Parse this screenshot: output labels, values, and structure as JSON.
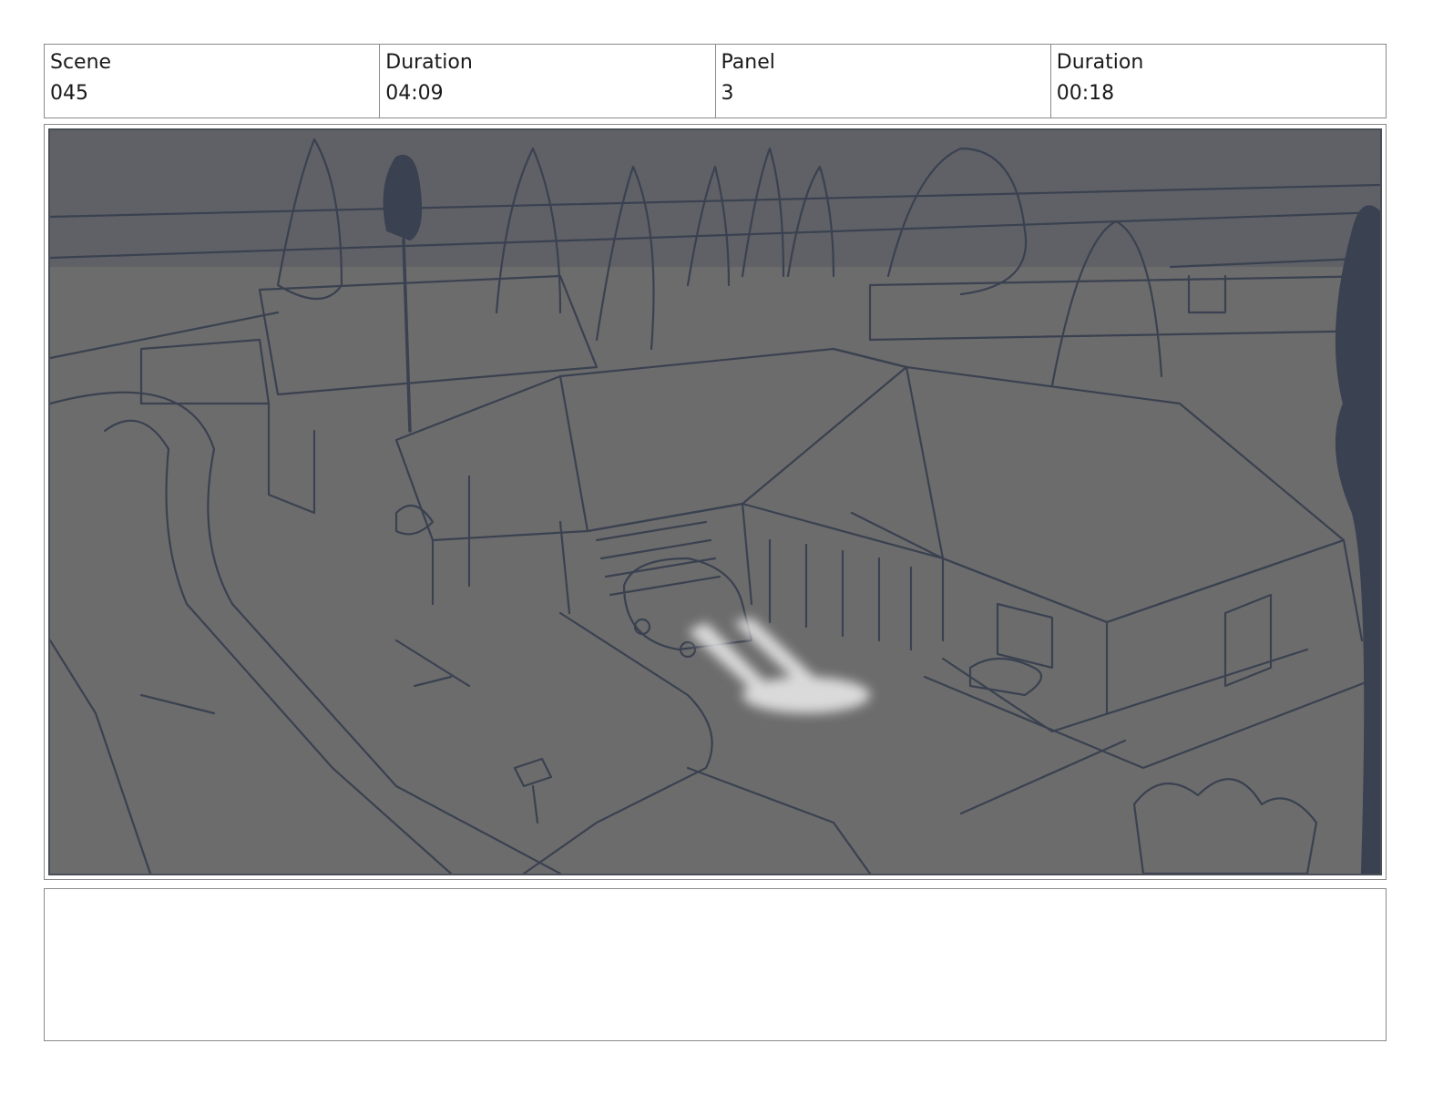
{
  "header": {
    "scene_label": "Scene",
    "scene_value": "045",
    "scene_duration_label": "Duration",
    "scene_duration_value": "04:09",
    "panel_label": "Panel",
    "panel_value": "3",
    "panel_duration_label": "Duration",
    "panel_duration_value": "00:18"
  },
  "panel": {
    "art_subject": "rough sketch of suburban house with car headlights in driveway",
    "line_color": "#3a4150",
    "fill_color": "#6c6c6c",
    "highlight_color": "#e6e6e6"
  },
  "notes": {
    "text": ""
  }
}
